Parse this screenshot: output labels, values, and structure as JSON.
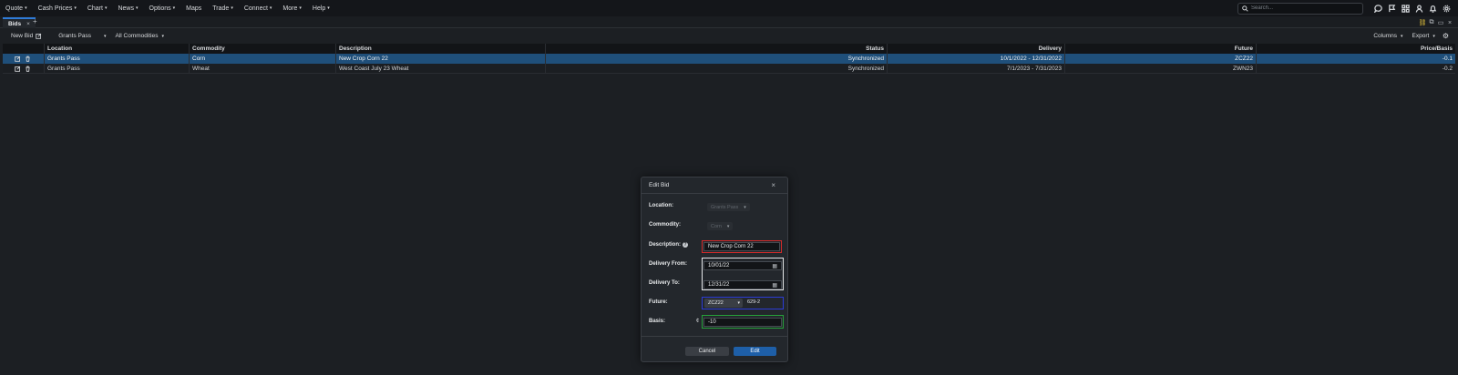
{
  "nav": {
    "menu": [
      {
        "label": "Quote",
        "caret": true
      },
      {
        "label": "Cash Prices",
        "caret": true
      },
      {
        "label": "Chart",
        "caret": true
      },
      {
        "label": "News",
        "caret": true
      },
      {
        "label": "Options",
        "caret": true
      },
      {
        "label": "Maps",
        "caret": false
      },
      {
        "label": "Trade",
        "caret": true
      },
      {
        "label": "Connect",
        "caret": true
      },
      {
        "label": "More",
        "caret": true
      },
      {
        "label": "Help",
        "caret": true
      }
    ],
    "search_placeholder": "Search...",
    "icons": [
      "chat-icon",
      "flag-icon",
      "grid-icon",
      "user-icon",
      "bell-icon",
      "gear-icon"
    ]
  },
  "tabs": {
    "active_label": "Bids",
    "close": "×",
    "add": "+"
  },
  "toolbar": {
    "new_bid_label": "New Bid",
    "location_filter": "Grants Pass",
    "commodity_filter": "All Commodities",
    "columns_label": "Columns",
    "export_label": "Export"
  },
  "grid": {
    "headers": {
      "location": "Location",
      "commodity": "Commodity",
      "description": "Description",
      "status": "Status",
      "delivery": "Delivery",
      "future": "Future",
      "price_basis": "Price/Basis"
    },
    "rows": [
      {
        "location": "Grants Pass",
        "commodity": "Corn",
        "description": "New Crop Corn 22",
        "status": "Synchronized",
        "delivery": "10/1/2022 - 12/31/2022",
        "future": "ZCZ22",
        "price_basis": "-0.1",
        "selected": true
      },
      {
        "location": "Grants Pass",
        "commodity": "Wheat",
        "description": "West Coast July 23 Wheat",
        "status": "Synchronized",
        "delivery": "7/1/2023 - 7/31/2023",
        "future": "ZWN23",
        "price_basis": "-0.2",
        "selected": false
      }
    ]
  },
  "modal": {
    "title": "Edit Bid",
    "close": "×",
    "location_label": "Location:",
    "location_value": "Grants Pass",
    "commodity_label": "Commodity:",
    "commodity_value": "Corn",
    "description_label": "Description:",
    "description_value": "New Crop Corn 22",
    "delivery_from_label": "Delivery From:",
    "delivery_from_value": "10/01/22",
    "delivery_to_label": "Delivery To:",
    "delivery_to_value": "12/31/22",
    "future_label": "Future:",
    "future_value": "ZCZ22",
    "future_price": "629-2",
    "basis_label": "Basis:",
    "basis_unit": "¢",
    "basis_value": "-10",
    "cancel_label": "Cancel",
    "edit_label": "Edit"
  },
  "colors": {
    "accent": "#2f7bd8",
    "selected_row": "#1f4f7a",
    "edit_button": "#1e5fa8",
    "highlight_red": "#d22a2a",
    "highlight_white": "#e6e8ea",
    "highlight_blue": "#2c3cd6",
    "highlight_green": "#27a13a"
  }
}
